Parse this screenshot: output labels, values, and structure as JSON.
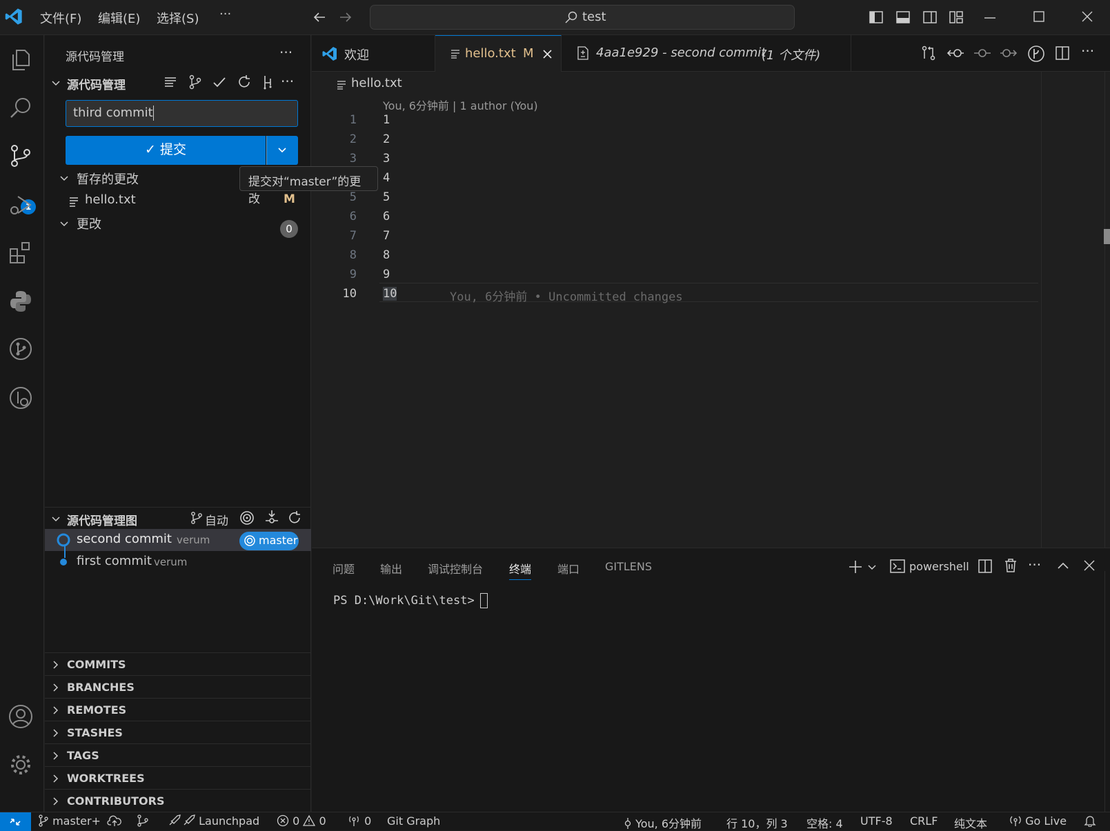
{
  "titlebar": {
    "menus": [
      "文件(F)",
      "编辑(E)",
      "选择(S)",
      "···"
    ],
    "search_text": "test"
  },
  "activity": {
    "scm_badge": "1"
  },
  "sidebar": {
    "header": "源代码管理",
    "more": "···",
    "scm_section_title": "源代码管理",
    "commit_message": "third commit",
    "commit_button": "✓ 提交",
    "tooltip": "提交对“master”的更改",
    "staged_label": "暂存的更改",
    "staged_file": "hello.txt",
    "staged_status": "M",
    "changes_label": "更改",
    "changes_count": "0",
    "graph_title": "源代码管理图",
    "graph_auto": "自动",
    "graph_commits": [
      {
        "message": "second commit",
        "author": "verum"
      },
      {
        "message": "first commit",
        "author": "verum"
      }
    ],
    "branch_tag": "master",
    "collapsed_sections": [
      "COMMITS",
      "BRANCHES",
      "REMOTES",
      "STASHES",
      "TAGS",
      "WORKTREES",
      "CONTRIBUTORS"
    ]
  },
  "tabs": [
    {
      "label": "欢迎"
    },
    {
      "label": "hello.txt",
      "badge": "M"
    },
    {
      "label": "4aa1e929 - second commit",
      "extra": "(1 个文件)"
    }
  ],
  "editor": {
    "breadcrumb": "hello.txt",
    "blame_header": "You, 6分钟前 | 1 author (You)",
    "lines": [
      "1",
      "2",
      "3",
      "4",
      "5",
      "6",
      "7",
      "8",
      "9",
      "10"
    ],
    "inline_blame": "You, 6分钟前 • Uncommitted changes"
  },
  "panel": {
    "tabs": [
      "问题",
      "输出",
      "调试控制台",
      "终端",
      "端口",
      "GITLENS"
    ],
    "active_tab": "终端",
    "shell": "powershell",
    "prompt": "PS D:\\Work\\Git\\test>"
  },
  "status": {
    "branch": "master+",
    "launchpad": "Launchpad",
    "errors": "0",
    "warnings": "0",
    "ports": "0",
    "git_graph": "Git Graph",
    "blame": "You, 6分钟前",
    "position": "行 10，列 3",
    "spaces": "空格: 4",
    "encoding": "UTF-8",
    "eol": "CRLF",
    "language": "纯文本",
    "golive": "Go Live"
  },
  "colors": {
    "accent": "#0078d4",
    "modified": "#e2c08d",
    "branch_tag": "#2489db"
  }
}
